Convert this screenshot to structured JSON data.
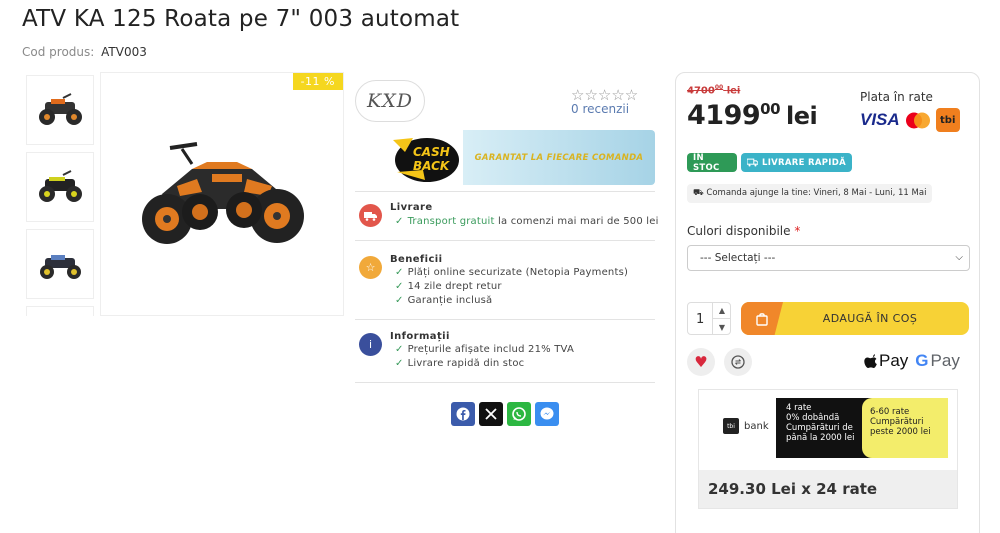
{
  "product": {
    "title": "ATV KA 125 Roata pe 7\" 003 automat",
    "code_label": "Cod produs:",
    "code": "ATV003",
    "discount": "-11 %"
  },
  "brand": {
    "name": "KXD"
  },
  "rating": {
    "stars": "☆☆☆☆☆",
    "reviews": "0 recenzii"
  },
  "cashback": {
    "banner_text": "GARANTAT LA FIECARE COMANDA",
    "logo_text_1": "CASH",
    "logo_text_2": "BACK"
  },
  "features": {
    "delivery": {
      "title": "Livrare",
      "highlight": "Transport gratuit",
      "line": "la comenzi mai mari de 500 lei"
    },
    "benefits": {
      "title": "Beneficii",
      "lines": [
        "Plăți online securizate (Netopia Payments)",
        "14 zile drept retur",
        "Garanție inclusă"
      ]
    },
    "info": {
      "title": "Informații",
      "lines": [
        "Prețurile afișate includ 21% TVA",
        "Livrare rapidă din stoc"
      ]
    }
  },
  "pricing": {
    "old_price_int": "4700",
    "old_price_dec": "00",
    "old_price_cur": "lei",
    "price_int": "4199",
    "price_dec": "00",
    "currency": "lei",
    "installments_label": "Plata în rate",
    "visa": "VISA",
    "tbi": "tbi"
  },
  "badges": {
    "stock": "ÎN STOC",
    "fast_delivery": "LIVRARE RAPIDĂ"
  },
  "delivery_estimate": "Comanda ajunge la tine: Vineri, 8 Mai - Luni, 11 Mai",
  "colors": {
    "label": "Culori disponibile",
    "required": "*",
    "selected": "--- Selectați ---"
  },
  "cart": {
    "quantity": "1",
    "add_label": "ADAUGĂ ÎN COȘ"
  },
  "wallets": {
    "apple_pay": "Pay",
    "google_pay": "Pay"
  },
  "tbi_bank": {
    "logo": "bank",
    "logo_sq": "tbi",
    "offer1": [
      "4 rate",
      "0% dobândă",
      "Cumpărături de",
      "până la 2000 lei"
    ],
    "offer2": [
      "6-60 rate",
      "Cumpărături",
      "peste 2000 lei"
    ],
    "total": "249.30 Lei x 24 rate"
  },
  "colors_theme": {
    "stock_green": "#2e9a57",
    "fast_teal": "#3bb3c8",
    "add_yellow": "#f7d236",
    "add_orange": "#f0872a",
    "discount_yellow": "#f5d71f"
  }
}
